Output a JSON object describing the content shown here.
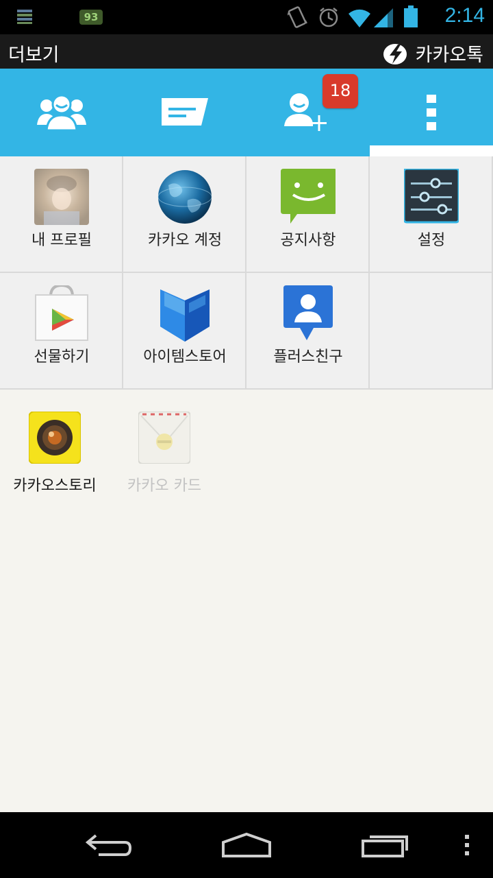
{
  "status_bar": {
    "battery_badge": "93",
    "time": "2:14",
    "icons": [
      "storage-icon",
      "vibrate-icon",
      "alarm-icon",
      "wifi-icon",
      "signal-icon",
      "battery-icon"
    ]
  },
  "header": {
    "title": "더보기",
    "brand": "카카오톡"
  },
  "tabs": {
    "items": [
      "friends-icon",
      "chats-icon",
      "add-friend-icon",
      "more-icon"
    ],
    "add_friend_badge": "18",
    "selected_index": 3
  },
  "grid": {
    "items": [
      {
        "label": "내 프로필",
        "icon": "profile-photo-icon"
      },
      {
        "label": "카카오 계정",
        "icon": "globe-icon"
      },
      {
        "label": "공지사항",
        "icon": "notice-chat-icon"
      },
      {
        "label": "설정",
        "icon": "settings-sliders-icon"
      },
      {
        "label": "선물하기",
        "icon": "play-store-bag-icon"
      },
      {
        "label": "아이템스토어",
        "icon": "book-store-icon"
      },
      {
        "label": "플러스친구",
        "icon": "plus-friend-icon"
      }
    ]
  },
  "apps": {
    "items": [
      {
        "label": "카카오스토리",
        "icon": "camera-lens-icon",
        "enabled": true
      },
      {
        "label": "카카오 카드",
        "icon": "card-envelope-icon",
        "enabled": false
      }
    ]
  },
  "nav_bar": {
    "buttons": [
      "back-icon",
      "home-icon",
      "recents-icon",
      "overflow-menu-icon"
    ]
  },
  "colors": {
    "accent": "#33b5e5",
    "badge": "#d83a2b",
    "title_bar": "#1a1a1a"
  }
}
